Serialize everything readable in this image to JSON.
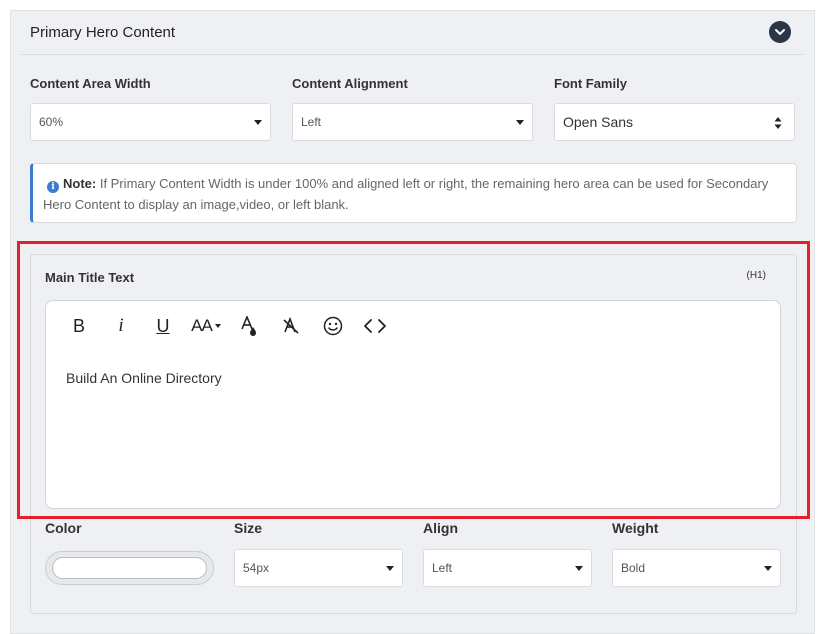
{
  "panel": {
    "title": "Primary Hero Content"
  },
  "layout_fields": {
    "content_area_width": {
      "label": "Content Area Width",
      "value": "60%"
    },
    "content_alignment": {
      "label": "Content Alignment",
      "value": "Left"
    },
    "font_family": {
      "label": "Font Family",
      "value": "Open Sans"
    }
  },
  "note": {
    "lead": "Note:",
    "text": "If Primary Content Width is under 100% and aligned left or right, the remaining hero area can be used for Secondary Hero Content to display an image,video, or left blank."
  },
  "main_title": {
    "label": "Main Title Text",
    "tag": "(H1)",
    "toolbar": {
      "bold": "B",
      "italic": "i",
      "underline": "U",
      "font_size": "AA"
    },
    "content": "Build An Online Directory"
  },
  "style_fields": {
    "color": {
      "label": "Color"
    },
    "size": {
      "label": "Size",
      "value": "54px"
    },
    "align": {
      "label": "Align",
      "value": "Left"
    },
    "weight": {
      "label": "Weight",
      "value": "Bold"
    }
  },
  "colors": {
    "highlight": "#e4202a",
    "accent": "#3a7bd5",
    "collapse_button": "#2a3644"
  }
}
